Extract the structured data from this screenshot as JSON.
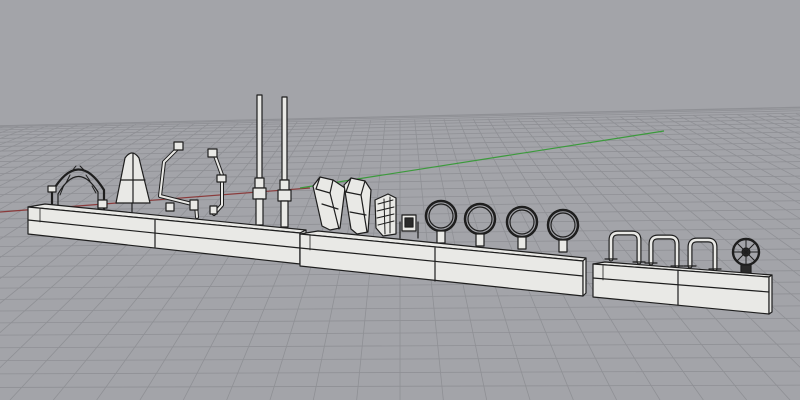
{
  "viewport": {
    "view": "perspective",
    "display_mode": "shaded",
    "background_color": "#a3a4a9",
    "grid": true,
    "grid_color": "#8f9095",
    "x_axis_color": "#8a3b3b",
    "y_axis_color": "#3c9a3c",
    "part_fill_color": "#e9e9e6",
    "part_edge_color": "#1e1e1e"
  },
  "model": {
    "sprue_count": 3,
    "sprues": [
      {
        "name": "sprue-1",
        "parts": [
          "arch",
          "fin",
          "bent-rod-1",
          "bent-rod-2",
          "antenna-1",
          "antenna-2"
        ]
      },
      {
        "name": "sprue-2",
        "parts": [
          "bracket-1",
          "bracket-2",
          "grill-block",
          "small-cube",
          "ring-1",
          "ring-2",
          "ring-3",
          "ring-4"
        ]
      },
      {
        "name": "sprue-3",
        "parts": [
          "handle-1",
          "handle-2",
          "handle-3",
          "spoked-wheel"
        ]
      }
    ]
  }
}
